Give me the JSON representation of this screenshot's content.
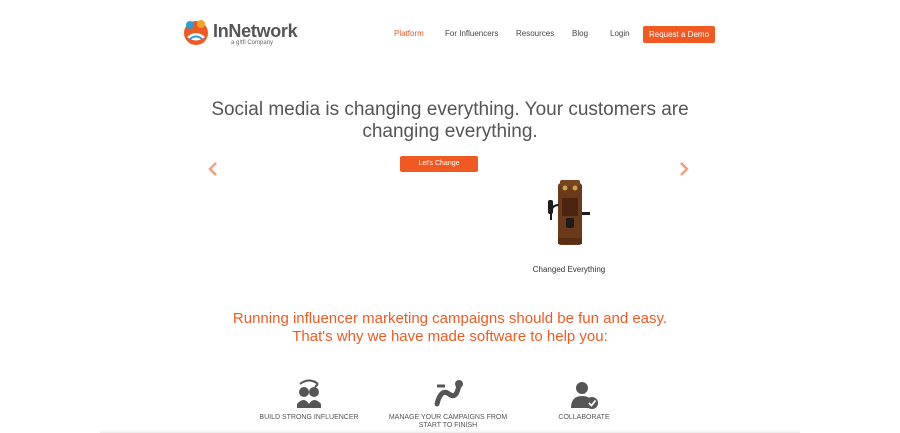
{
  "colors": {
    "accent": "#f05a22",
    "text": "#555555"
  },
  "header": {
    "logo_name": "InNetwork",
    "logo_tag": "a g!tfi Company",
    "nav": [
      "Platform",
      "For Influencers",
      "Resources",
      "Blog",
      "Login"
    ],
    "cta_label": "Request a Demo"
  },
  "hero": {
    "title_line1": "Social media is changing everything. Your customers are",
    "title_line2": "changing everything.",
    "cta": "Let's Change",
    "slide_caption": "Changed Everything",
    "prev_icon": "chevron-left-icon",
    "next_icon": "chevron-right-icon"
  },
  "tagline": {
    "line1": "Running influencer marketing campaigns should be fun and easy.",
    "line2": "That's why we have made software to help you:"
  },
  "features": [
    {
      "label": "BUILD STRONG INFLUENCER",
      "icon": "people-exchange-icon"
    },
    {
      "label": "MANAGE YOUR CAMPAIGNS FROM START TO FINISH",
      "icon": "flow-icon"
    },
    {
      "label": "COLLABORATE",
      "icon": "user-check-icon"
    }
  ]
}
